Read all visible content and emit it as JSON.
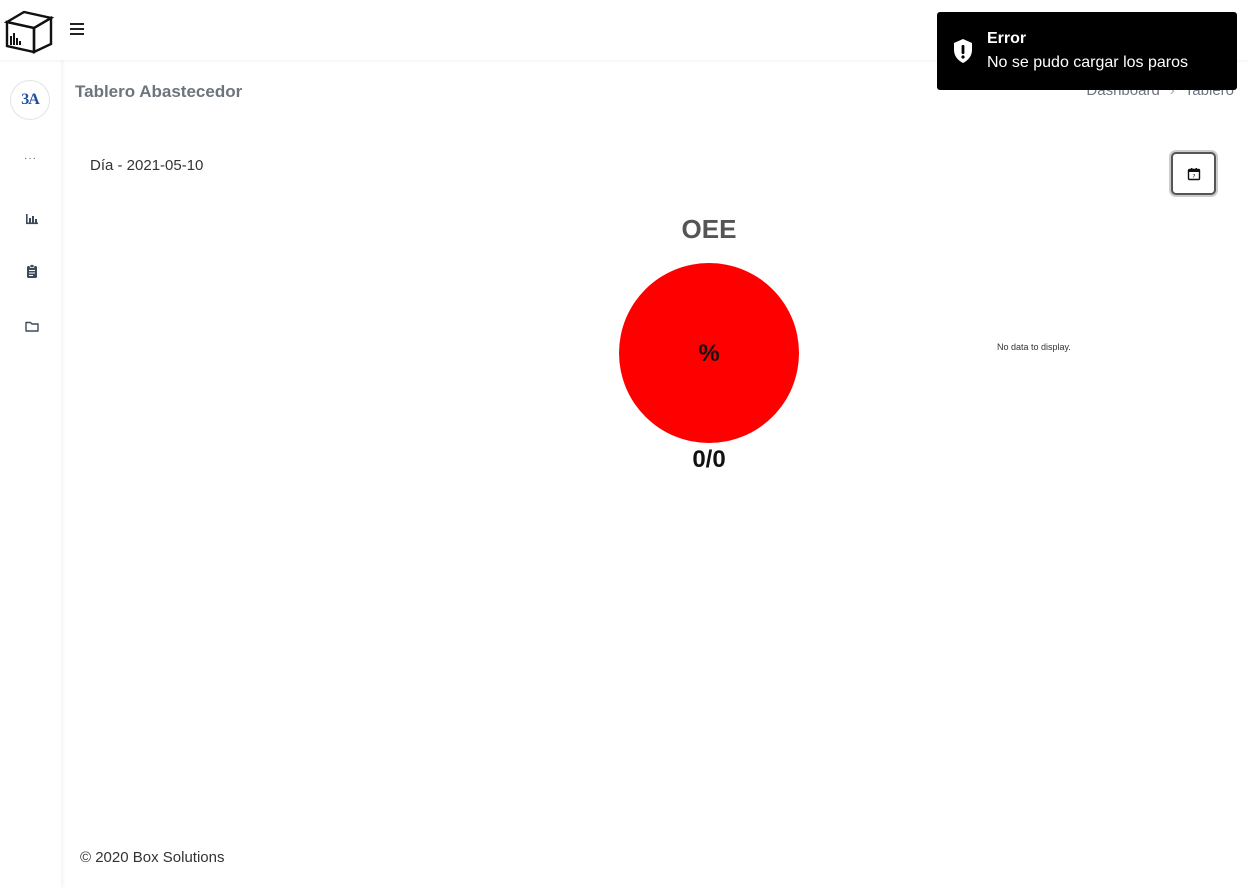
{
  "header": {
    "logo_icon": "box-logo-icon",
    "menu_icon": "hamburger-menu-icon"
  },
  "sidebar": {
    "avatar_text": "3A",
    "dots": "···",
    "items": [
      {
        "icon": "bar-chart-icon"
      },
      {
        "icon": "clipboard-icon"
      },
      {
        "icon": "folder-icon"
      }
    ]
  },
  "page": {
    "title": "Tablero Abastecedor",
    "breadcrumb": [
      "Dashboard",
      "Tablero"
    ],
    "breadcrumb_separator": "›",
    "date_label": "Día - 2021-05-10",
    "calendar_icon": "calendar-icon"
  },
  "chart_data": {
    "type": "pie",
    "title": "OEE",
    "center_label": "%",
    "ratio_label": "0/0",
    "color": "#ff0000",
    "empty_message": "No data to display."
  },
  "footer": {
    "text": "© 2020 Box Solutions"
  },
  "toast": {
    "icon": "shield-alert-icon",
    "title": "Error",
    "message": "No se pudo cargar los paros",
    "background": "#000000"
  }
}
